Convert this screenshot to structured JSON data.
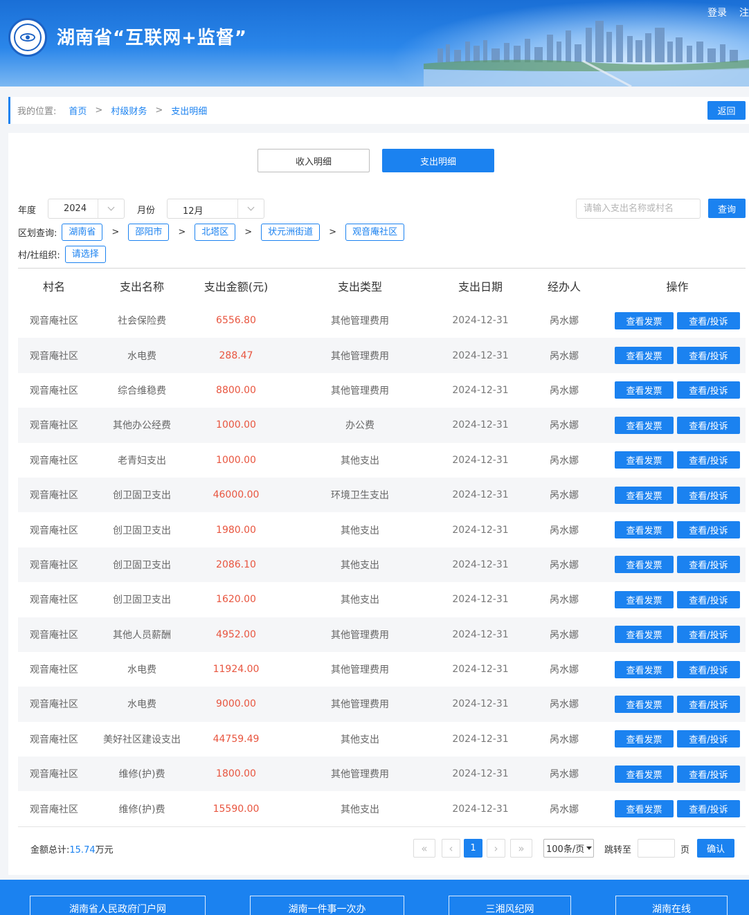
{
  "header": {
    "title": "湖南省“互联网+监督”",
    "links": [
      "登录",
      "注"
    ]
  },
  "breadcrumb": {
    "label": "我的位置:",
    "items": [
      "首页",
      "村级财务",
      "支出明细"
    ],
    "separator": ">",
    "back_label": "返回"
  },
  "tabs": {
    "income": "收入明细",
    "expense": "支出明细",
    "active": "expense"
  },
  "filters": {
    "year_label": "年度",
    "year_value": "2024",
    "month_label": "月份",
    "month_value": "12月",
    "search_placeholder": "请输入支出名称或村名",
    "query_label": "查询",
    "region_label": "区划查询:",
    "regions": [
      "湖南省",
      "邵阳市",
      "北塔区",
      "状元洲街道",
      "观音庵社区"
    ],
    "region_separator": ">",
    "village_label": "村/社组织:",
    "village_select": "请选择"
  },
  "table": {
    "headers": [
      "村名",
      "支出名称",
      "支出金额(元)",
      "支出类型",
      "支出日期",
      "经办人",
      "操作"
    ],
    "action_labels": [
      "查看发票",
      "查看/投诉"
    ],
    "rows": [
      [
        "观音庵社区",
        "社会保险费",
        "6556.80",
        "其他管理费用",
        "2024-12-31",
        "呙水娜"
      ],
      [
        "观音庵社区",
        "水电费",
        "288.47",
        "其他管理费用",
        "2024-12-31",
        "呙水娜"
      ],
      [
        "观音庵社区",
        "综合维稳费",
        "8800.00",
        "其他管理费用",
        "2024-12-31",
        "呙水娜"
      ],
      [
        "观音庵社区",
        "其他办公经费",
        "1000.00",
        "办公费",
        "2024-12-31",
        "呙水娜"
      ],
      [
        "观音庵社区",
        "老青妇支出",
        "1000.00",
        "其他支出",
        "2024-12-31",
        "呙水娜"
      ],
      [
        "观音庵社区",
        "创卫固卫支出",
        "46000.00",
        "环境卫生支出",
        "2024-12-31",
        "呙水娜"
      ],
      [
        "观音庵社区",
        "创卫固卫支出",
        "1980.00",
        "其他支出",
        "2024-12-31",
        "呙水娜"
      ],
      [
        "观音庵社区",
        "创卫固卫支出",
        "2086.10",
        "其他支出",
        "2024-12-31",
        "呙水娜"
      ],
      [
        "观音庵社区",
        "创卫固卫支出",
        "1620.00",
        "其他支出",
        "2024-12-31",
        "呙水娜"
      ],
      [
        "观音庵社区",
        "其他人员薪酬",
        "4952.00",
        "其他管理费用",
        "2024-12-31",
        "呙水娜"
      ],
      [
        "观音庵社区",
        "水电费",
        "11924.00",
        "其他管理费用",
        "2024-12-31",
        "呙水娜"
      ],
      [
        "观音庵社区",
        "水电费",
        "9000.00",
        "其他管理费用",
        "2024-12-31",
        "呙水娜"
      ],
      [
        "观音庵社区",
        "美好社区建设支出",
        "44759.49",
        "其他支出",
        "2024-12-31",
        "呙水娜"
      ],
      [
        "观音庵社区",
        "维修(护)费",
        "1800.00",
        "其他管理费用",
        "2024-12-31",
        "呙水娜"
      ],
      [
        "观音庵社区",
        "维修(护)费",
        "15590.00",
        "其他支出",
        "2024-12-31",
        "呙水娜"
      ]
    ]
  },
  "summary": {
    "label": "金额总计:",
    "value": "15.74",
    "unit": "万元"
  },
  "pagination": {
    "first": "«",
    "prev": "‹",
    "current": "1",
    "next": "›",
    "last": "»",
    "per_page": "100条/页",
    "jump_label": "跳转至",
    "page_label": "页",
    "confirm": "确认"
  },
  "footer_links": [
    "湖南省人民政府门户网",
    "湖南一件事一次办",
    "三湘风纪网",
    "湖南在线"
  ],
  "colors": {
    "primary": "#1b82f0",
    "amount": "#e8553f"
  }
}
